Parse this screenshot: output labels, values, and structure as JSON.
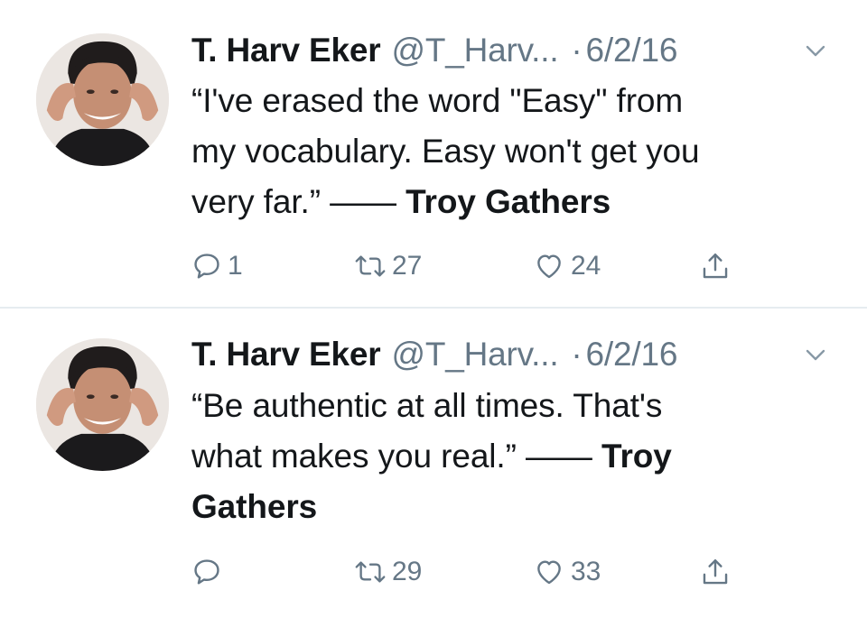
{
  "tweets": [
    {
      "author": "T. Harv Eker",
      "handle": "@T_Harv...",
      "separator": "·",
      "date": "6/2/16",
      "text_plain": "“I've erased the word \"Easy\" from\nmy vocabulary. Easy won't get you\nvery far.” —— ",
      "text_bold": "Troy Gathers",
      "reply_count": "1",
      "retweet_count": "27",
      "like_count": "24"
    },
    {
      "author": "T. Harv Eker",
      "handle": "@T_Harv...",
      "separator": "·",
      "date": "6/2/16",
      "text_plain": "“Be authentic at all times. That's\nwhat makes you real.” —— ",
      "text_bold": "Troy\nGathers",
      "reply_count": "",
      "retweet_count": "29",
      "like_count": "33"
    }
  ],
  "icons": {
    "reply": "reply-icon",
    "retweet": "retweet-icon",
    "like": "heart-icon",
    "share": "share-icon",
    "menu": "chevron-down-icon",
    "avatar": "profile-photo"
  },
  "colors": {
    "text": "#14171a",
    "secondary": "#657786",
    "divider": "#e6ecf0"
  }
}
